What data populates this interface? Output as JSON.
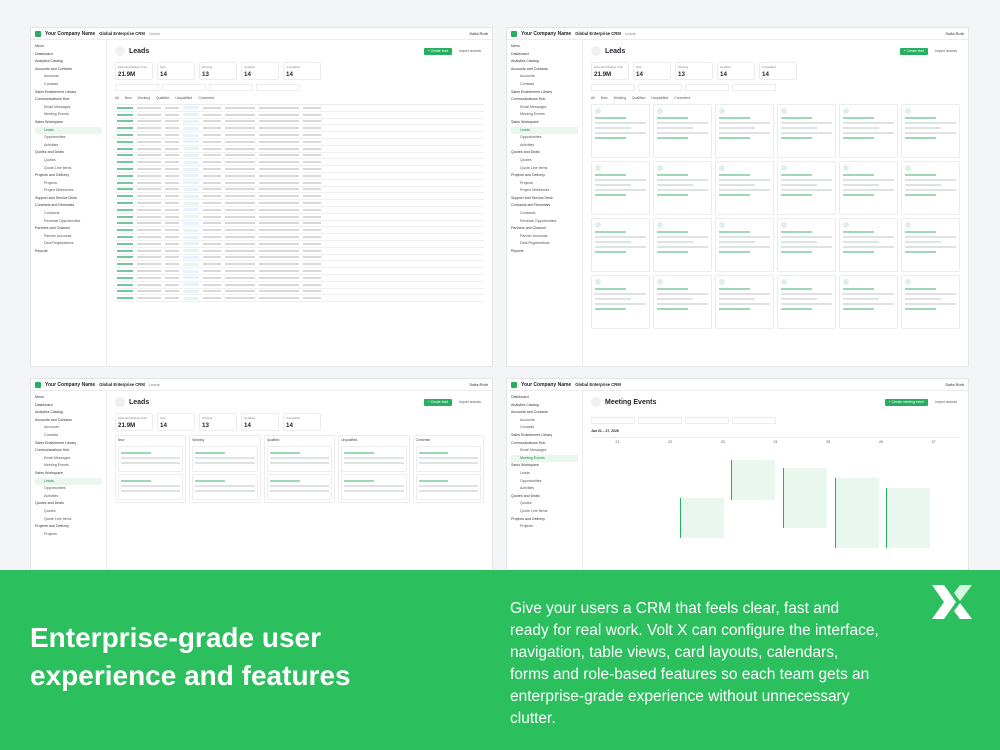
{
  "app": {
    "company": "Your Company Name",
    "product": "Global Enterprise CRM",
    "crumb": "Leads",
    "user": "Sofia Roth"
  },
  "sidebar": {
    "menu_label": "Menu",
    "items": [
      "Dashboard",
      "Analytics Catalog",
      "Accounts and Contacts",
      "Accounts",
      "Contacts",
      "Sales Enablement Library",
      "Communications Hub",
      "Email Messages",
      "Meeting Events",
      "Sales Workspace",
      "Leads",
      "Opportunities",
      "Activities",
      "Quotes and Deals",
      "Quotes",
      "Quote Line Items",
      "Projects and Delivery",
      "Projects",
      "Project Milestones",
      "Support and Service Desk",
      "Contracts and Renewals",
      "Contracts",
      "Renewal Opportunities",
      "Partners and Channel",
      "Partner Accounts",
      "Deal Registrations",
      "Reports"
    ]
  },
  "leads": {
    "title": "Leads",
    "create_label": "+ Create lead",
    "import_label": "Import records",
    "stats": [
      {
        "label": "Estimated Budget Total",
        "value": "21.9M"
      },
      {
        "label": "New",
        "value": "14"
      },
      {
        "label": "Working",
        "value": "13"
      },
      {
        "label": "Qualified",
        "value": "14"
      },
      {
        "label": "Unqualified",
        "value": "14"
      }
    ],
    "tabs": [
      "All",
      "New",
      "Working",
      "Qualified",
      "Unqualified",
      "Converted"
    ]
  },
  "meetings": {
    "title": "Meeting Events",
    "create_label": "+ Create meeting event",
    "import_label": "Import records",
    "range": "Jun 21 – 27, 2026",
    "days": [
      "21",
      "22",
      "23",
      "24",
      "25",
      "26",
      "27"
    ]
  },
  "kanban": {
    "columns": [
      "New",
      "Working",
      "Qualified",
      "Unqualified",
      "Converted"
    ]
  },
  "marketing": {
    "headline": "Enterprise-grade user experience and features",
    "body": "Give your users a CRM that feels clear, fast and ready for real work. Volt X can configure the interface, navigation, table views, card layouts, calendars, forms and role-based features so each team gets an enterprise-grade experience without unnecessary clutter."
  },
  "colors": {
    "accent": "#2bbf5e",
    "banner": "#2bbf5e",
    "text_on_banner": "#ffffff"
  }
}
